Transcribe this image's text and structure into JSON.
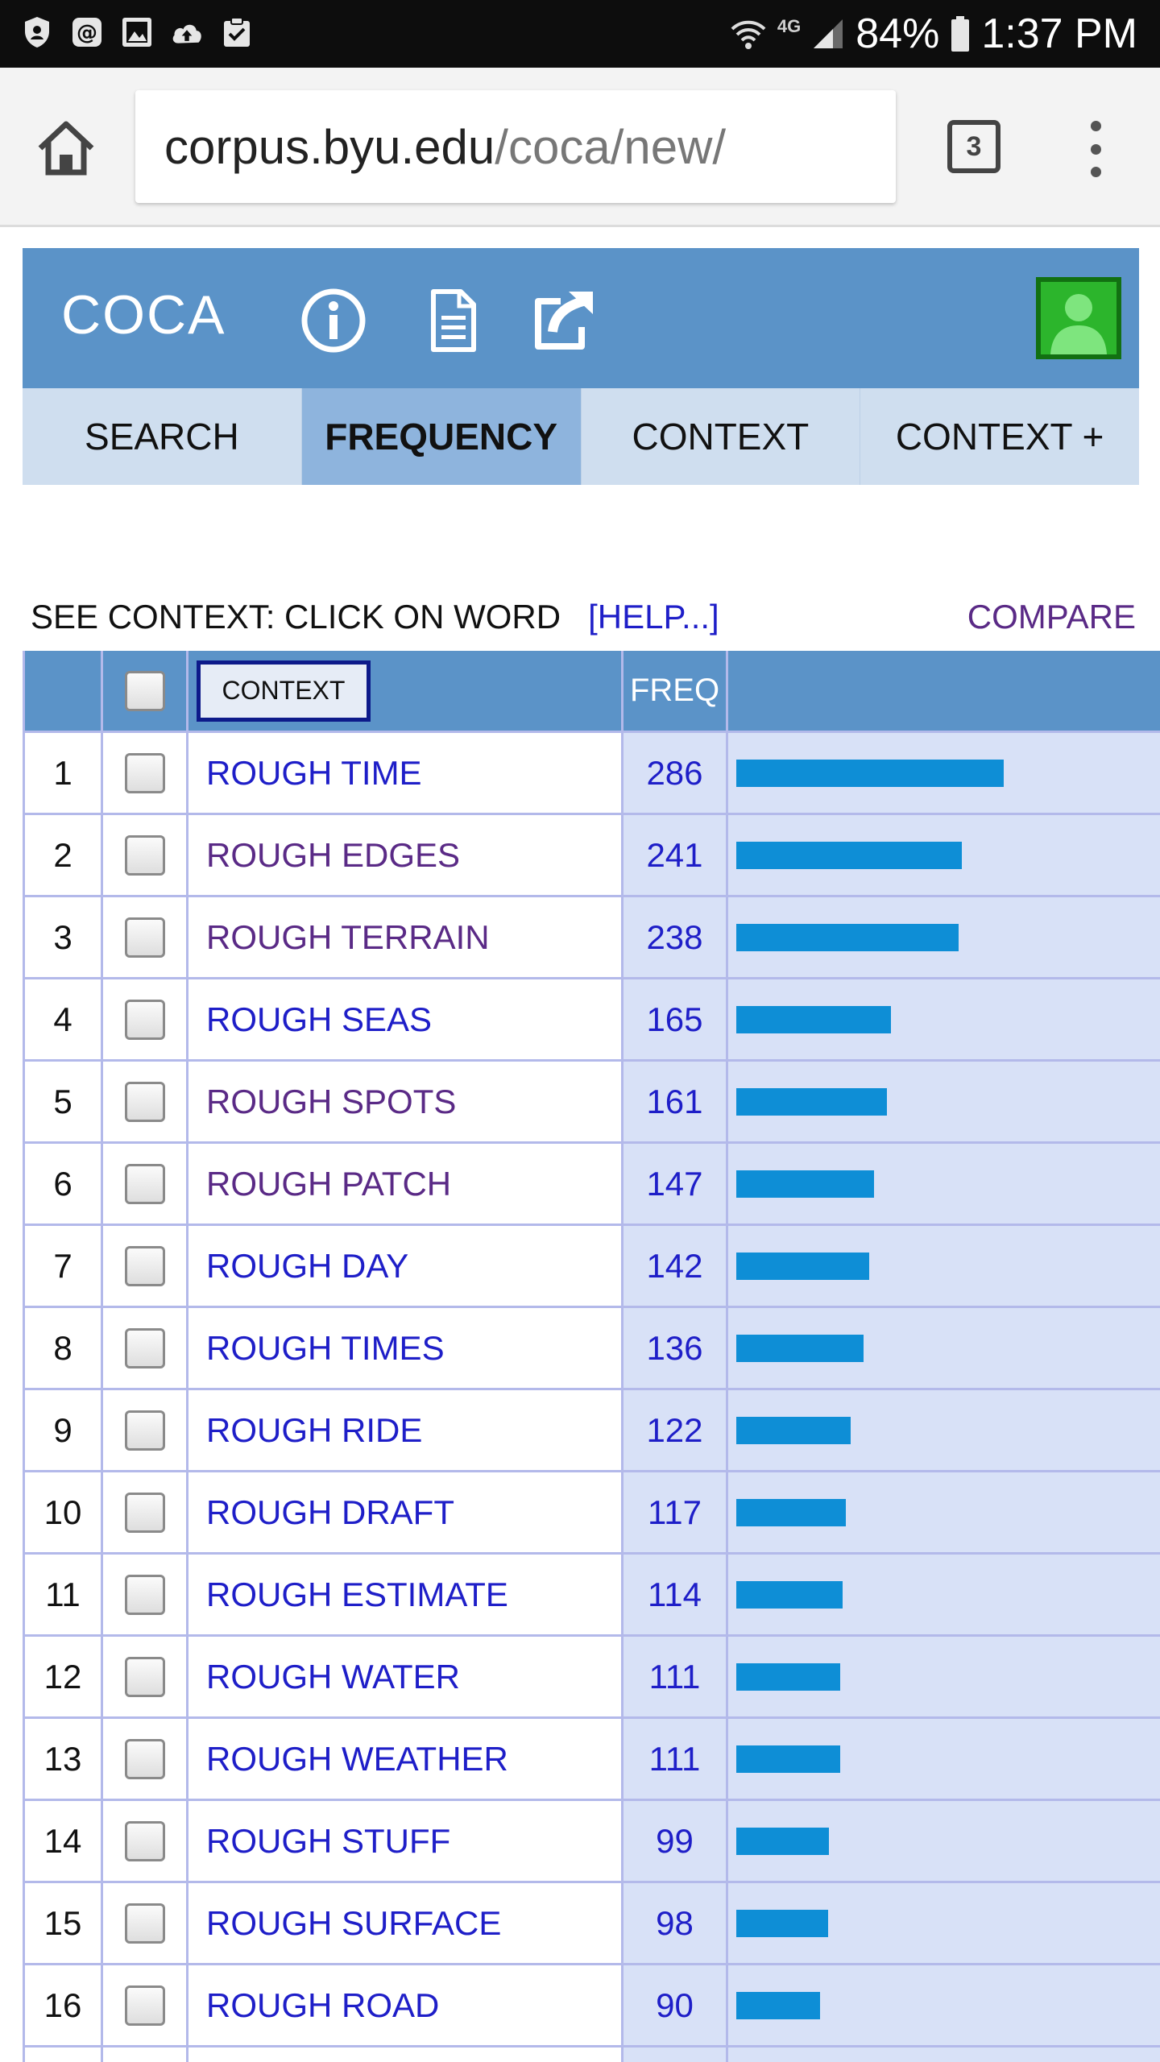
{
  "status_bar": {
    "battery_percent": "84%",
    "time": "1:37 PM",
    "network": "4G",
    "left_icons": [
      "shield-icon",
      "at-sign-icon",
      "image-icon",
      "cloud-upload-icon",
      "clipboard-check-icon"
    ]
  },
  "browser": {
    "url_host": "corpus.byu.edu",
    "url_path": "/coca/new/",
    "tab_count": "3"
  },
  "coca": {
    "title": "COCA",
    "header_icons": [
      "info-icon",
      "document-icon",
      "external-link-icon",
      "user-avatar-icon"
    ],
    "tabs": [
      {
        "label": "SEARCH",
        "active": false
      },
      {
        "label": "FREQUENCY",
        "active": true
      },
      {
        "label": "CONTEXT",
        "active": false
      },
      {
        "label": "CONTEXT +",
        "active": false
      }
    ],
    "see_context_label": "SEE CONTEXT: CLICK ON WORD",
    "help_label": "[HELP...]",
    "compare_label": "COMPARE"
  },
  "table": {
    "header": {
      "context_button": "CONTEXT",
      "freq_label": "FREQ"
    },
    "max_freq": 286,
    "bar_color": "#0e8ed6",
    "rows": [
      {
        "num": "1",
        "word": "ROUGH TIME",
        "freq": "286",
        "visited": false
      },
      {
        "num": "2",
        "word": "ROUGH EDGES",
        "freq": "241",
        "visited": true
      },
      {
        "num": "3",
        "word": "ROUGH TERRAIN",
        "freq": "238",
        "visited": true
      },
      {
        "num": "4",
        "word": "ROUGH SEAS",
        "freq": "165",
        "visited": false
      },
      {
        "num": "5",
        "word": "ROUGH SPOTS",
        "freq": "161",
        "visited": true
      },
      {
        "num": "6",
        "word": "ROUGH PATCH",
        "freq": "147",
        "visited": true
      },
      {
        "num": "7",
        "word": "ROUGH DAY",
        "freq": "142",
        "visited": false
      },
      {
        "num": "8",
        "word": "ROUGH TIMES",
        "freq": "136",
        "visited": false
      },
      {
        "num": "9",
        "word": "ROUGH RIDE",
        "freq": "122",
        "visited": false
      },
      {
        "num": "10",
        "word": "ROUGH DRAFT",
        "freq": "117",
        "visited": false
      },
      {
        "num": "11",
        "word": "ROUGH ESTIMATE",
        "freq": "114",
        "visited": false
      },
      {
        "num": "12",
        "word": "ROUGH WATER",
        "freq": "111",
        "visited": false
      },
      {
        "num": "13",
        "word": "ROUGH WEATHER",
        "freq": "111",
        "visited": false
      },
      {
        "num": "14",
        "word": "ROUGH STUFF",
        "freq": "99",
        "visited": false
      },
      {
        "num": "15",
        "word": "ROUGH SURFACE",
        "freq": "98",
        "visited": false
      },
      {
        "num": "16",
        "word": "ROUGH ROAD",
        "freq": "90",
        "visited": false
      },
      {
        "num": "",
        "word": "",
        "freq": "",
        "visited": false
      }
    ]
  }
}
